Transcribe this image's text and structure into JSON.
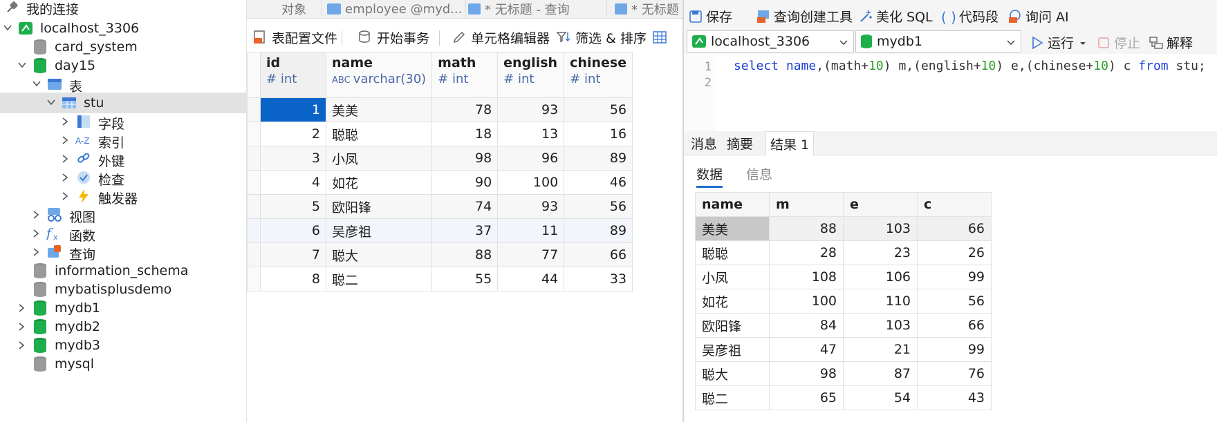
{
  "sidebar": {
    "title": "我的连接",
    "items": [
      {
        "label": "localhost_3306",
        "icon": "connection-icon"
      },
      {
        "label": "card_system",
        "icon": "database-gray-icon"
      },
      {
        "label": "day15",
        "icon": "database-green-icon"
      },
      {
        "label": "表",
        "icon": "tables-folder-icon"
      },
      {
        "label": "stu",
        "icon": "table-icon"
      },
      {
        "label": "字段",
        "icon": "fields-icon"
      },
      {
        "label": "索引",
        "icon": "index-icon"
      },
      {
        "label": "外键",
        "icon": "foreign-key-icon"
      },
      {
        "label": "检查",
        "icon": "check-icon"
      },
      {
        "label": "触发器",
        "icon": "trigger-icon"
      },
      {
        "label": "视图",
        "icon": "view-icon"
      },
      {
        "label": "函数",
        "icon": "function-icon"
      },
      {
        "label": "查询",
        "icon": "query-icon"
      },
      {
        "label": "information_schema",
        "icon": "database-gray-icon"
      },
      {
        "label": "mybatisplusdemo",
        "icon": "database-gray-icon"
      },
      {
        "label": "mydb1",
        "icon": "database-green-icon"
      },
      {
        "label": "mydb2",
        "icon": "database-green-icon"
      },
      {
        "label": "mydb3",
        "icon": "database-green-icon"
      },
      {
        "label": "mysql",
        "icon": "database-gray-icon"
      }
    ]
  },
  "tabs": [
    {
      "label": "对象"
    },
    {
      "label": "employee @myd..."
    },
    {
      "label": "* 无标题 - 查询"
    },
    {
      "label": "* 无标题"
    }
  ],
  "table_toolbar": {
    "config": "表配置文件",
    "transaction": "开始事务",
    "cell_editor": "单元格编辑器",
    "filter_sort": "筛选 & 排序"
  },
  "table_grid": {
    "columns": [
      {
        "name": "id",
        "type": "int"
      },
      {
        "name": "name",
        "type": "varchar(30)"
      },
      {
        "name": "math",
        "type": "int"
      },
      {
        "name": "english",
        "type": "int"
      },
      {
        "name": "chinese",
        "type": "int"
      }
    ],
    "rows": [
      [
        "1",
        "美美",
        "78",
        "93",
        "56"
      ],
      [
        "2",
        "聪聪",
        "18",
        "13",
        "16"
      ],
      [
        "3",
        "小凤",
        "98",
        "96",
        "89"
      ],
      [
        "4",
        "如花",
        "90",
        "100",
        "46"
      ],
      [
        "5",
        "欧阳锋",
        "74",
        "93",
        "56"
      ],
      [
        "6",
        "吴彦祖",
        "37",
        "11",
        "89"
      ],
      [
        "7",
        "聪大",
        "88",
        "77",
        "66"
      ],
      [
        "8",
        "聪二",
        "55",
        "44",
        "33"
      ]
    ]
  },
  "query_toolbar": {
    "save": "保存",
    "query_builder": "查询创建工具",
    "beautify": "美化 SQL",
    "snippet": "代码段",
    "ask_ai": "询问 AI",
    "connection": "localhost_3306",
    "database": "mydb1",
    "run": "运行",
    "stop": "停止",
    "explain": "解释"
  },
  "editor": {
    "line_numbers": [
      "1",
      "2"
    ]
  },
  "result_tabs": [
    {
      "label": "消息"
    },
    {
      "label": "摘要"
    },
    {
      "label": "结果 1"
    }
  ],
  "result_subtabs": [
    {
      "label": "数据"
    },
    {
      "label": "信息"
    }
  ],
  "result_grid": {
    "columns": [
      "name",
      "m",
      "e",
      "c"
    ],
    "rows": [
      [
        "美美",
        "88",
        "103",
        "66"
      ],
      [
        "聪聪",
        "28",
        "23",
        "26"
      ],
      [
        "小凤",
        "108",
        "106",
        "99"
      ],
      [
        "如花",
        "100",
        "110",
        "56"
      ],
      [
        "欧阳锋",
        "84",
        "103",
        "66"
      ],
      [
        "吴彦祖",
        "47",
        "21",
        "99"
      ],
      [
        "聪大",
        "98",
        "87",
        "76"
      ],
      [
        "聪二",
        "65",
        "54",
        "43"
      ]
    ]
  },
  "colors": {
    "accent": "#1f6fd0",
    "selection": "#0a64c8",
    "keyword": "#1a3fd8",
    "number": "#2aa02a",
    "db_green": "#1fae4c"
  }
}
